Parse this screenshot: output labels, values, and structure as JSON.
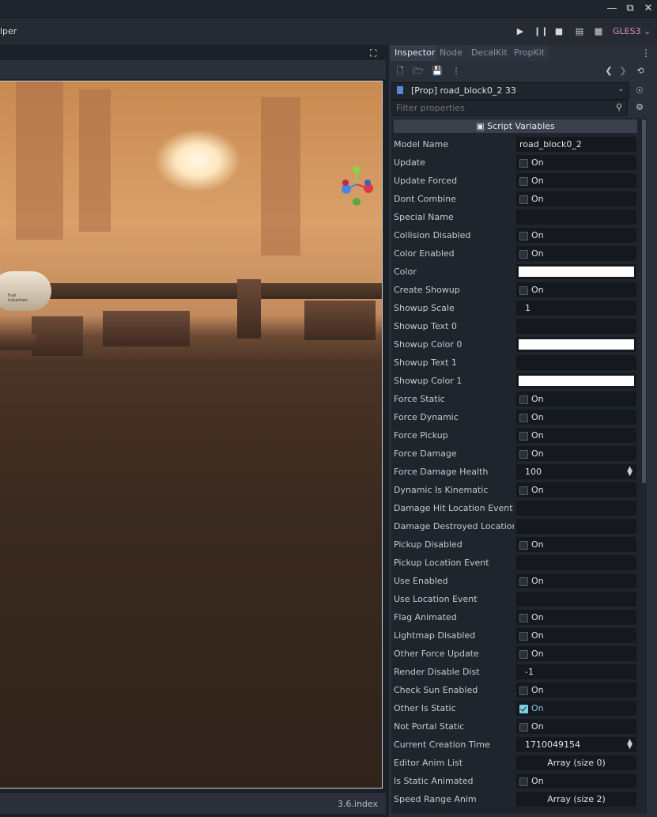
{
  "menubar": {
    "title_fragment": "lper",
    "renderer": "GLES3"
  },
  "viewport": {
    "tank_text": "Fuel\nIndustries"
  },
  "statusbar": {
    "version": "3.6.index"
  },
  "inspector": {
    "tabs": [
      "Inspector",
      "Node",
      "DecalKit",
      "PropKit"
    ],
    "object_name": "[Prop] road_block0_2 33",
    "filter_placeholder": "Filter properties",
    "section": "Script Variables",
    "properties": [
      {
        "label": "Model Name",
        "kind": "text",
        "value": "road_block0_2"
      },
      {
        "label": "Update",
        "kind": "check",
        "checked": false,
        "value": "On"
      },
      {
        "label": "Update Forced",
        "kind": "check",
        "checked": false,
        "value": "On"
      },
      {
        "label": "Dont Combine",
        "kind": "check",
        "checked": false,
        "value": "On"
      },
      {
        "label": "Special Name",
        "kind": "text",
        "value": ""
      },
      {
        "label": "Collision Disabled",
        "kind": "check",
        "checked": false,
        "value": "On"
      },
      {
        "label": "Color Enabled",
        "kind": "check",
        "checked": false,
        "value": "On"
      },
      {
        "label": "Color",
        "kind": "color",
        "color": "#ffffff"
      },
      {
        "label": "Create Showup",
        "kind": "check",
        "checked": false,
        "value": "On"
      },
      {
        "label": "Showup Scale",
        "kind": "num",
        "value": "1"
      },
      {
        "label": "Showup Text 0",
        "kind": "text",
        "value": ""
      },
      {
        "label": "Showup Color 0",
        "kind": "color",
        "color": "#ffffff"
      },
      {
        "label": "Showup Text 1",
        "kind": "text",
        "value": ""
      },
      {
        "label": "Showup Color 1",
        "kind": "color",
        "color": "#ffffff"
      },
      {
        "label": "Force Static",
        "kind": "check",
        "checked": false,
        "value": "On"
      },
      {
        "label": "Force Dynamic",
        "kind": "check",
        "checked": false,
        "value": "On"
      },
      {
        "label": "Force Pickup",
        "kind": "check",
        "checked": false,
        "value": "On"
      },
      {
        "label": "Force Damage",
        "kind": "check",
        "checked": false,
        "value": "On"
      },
      {
        "label": "Force Damage Health",
        "kind": "spin",
        "value": "100"
      },
      {
        "label": "Dynamic Is Kinematic",
        "kind": "check",
        "checked": false,
        "value": "On"
      },
      {
        "label": "Damage Hit Location Event",
        "kind": "text",
        "value": ""
      },
      {
        "label": "Damage Destroyed Location Ev",
        "kind": "text",
        "value": ""
      },
      {
        "label": "Pickup Disabled",
        "kind": "check",
        "checked": false,
        "value": "On"
      },
      {
        "label": "Pickup Location Event",
        "kind": "text",
        "value": ""
      },
      {
        "label": "Use Enabled",
        "kind": "check",
        "checked": false,
        "value": "On"
      },
      {
        "label": "Use Location Event",
        "kind": "text",
        "value": ""
      },
      {
        "label": "Flag Animated",
        "kind": "check",
        "checked": false,
        "value": "On"
      },
      {
        "label": "Lightmap Disabled",
        "kind": "check",
        "checked": false,
        "value": "On"
      },
      {
        "label": "Other Force Update",
        "kind": "check",
        "checked": false,
        "value": "On"
      },
      {
        "label": "Render Disable Dist",
        "kind": "num",
        "value": "-1"
      },
      {
        "label": "Check Sun Enabled",
        "kind": "check",
        "checked": false,
        "value": "On"
      },
      {
        "label": "Other Is Static",
        "kind": "check",
        "checked": true,
        "value": "On"
      },
      {
        "label": "Not Portal Static",
        "kind": "check",
        "checked": false,
        "value": "On"
      },
      {
        "label": "Current Creation Time",
        "kind": "spin",
        "value": "1710049154"
      },
      {
        "label": "Editor Anim List",
        "kind": "array",
        "value": "Array (size 0)"
      },
      {
        "label": "Is Static Animated",
        "kind": "check",
        "checked": false,
        "value": "On"
      },
      {
        "label": "Speed Range Anim",
        "kind": "array",
        "value": "Array (size 2)"
      }
    ]
  }
}
